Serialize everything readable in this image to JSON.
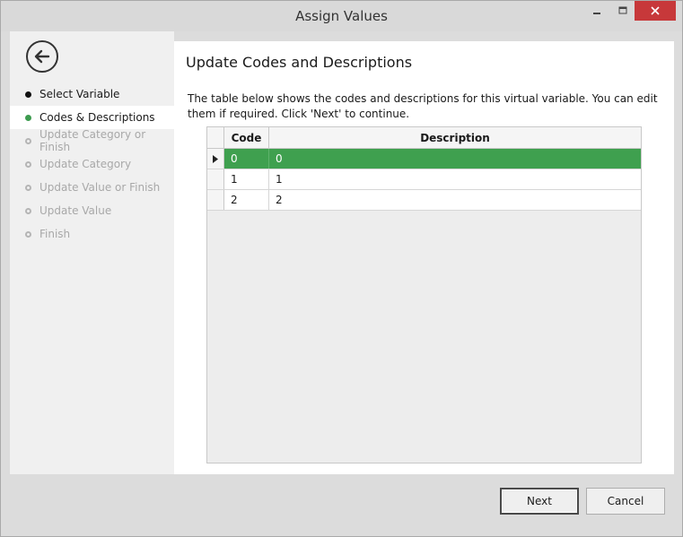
{
  "window": {
    "title": "Assign Values",
    "minimize_glyph": "—",
    "maximize_glyph": "☐",
    "close_glyph": "✕"
  },
  "sidebar": {
    "back_icon": "back-arrow-icon",
    "items": [
      {
        "label": "Select Variable",
        "state": "done"
      },
      {
        "label": "Codes & Descriptions",
        "state": "active"
      },
      {
        "label": "Update Category or Finish",
        "state": "disabled"
      },
      {
        "label": "Update Category",
        "state": "disabled"
      },
      {
        "label": "Update Value or Finish",
        "state": "disabled"
      },
      {
        "label": "Update Value",
        "state": "disabled"
      },
      {
        "label": "Finish",
        "state": "disabled"
      }
    ]
  },
  "main": {
    "heading": "Update Codes and Descriptions",
    "description": "The table below shows the codes and descriptions for this virtual variable. You can edit them if required. Click 'Next' to continue.",
    "table": {
      "columns": [
        "Code",
        "Description"
      ],
      "rows": [
        {
          "code": "0",
          "description": "0",
          "selected": true
        },
        {
          "code": "1",
          "description": "1",
          "selected": false
        },
        {
          "code": "2",
          "description": "2",
          "selected": false
        }
      ]
    }
  },
  "footer": {
    "next_label": "Next",
    "cancel_label": "Cancel"
  },
  "colors": {
    "accent_green": "#3fa04f",
    "close_red": "#c7383a"
  }
}
